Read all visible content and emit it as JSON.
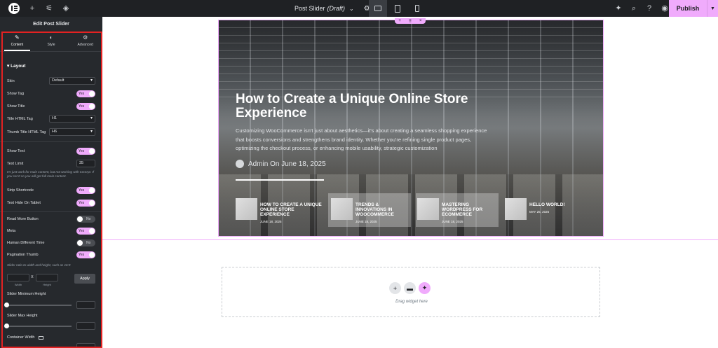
{
  "topbar": {
    "page_name": "Post Slider",
    "page_status": "(Draft)",
    "publish_label": "Publish"
  },
  "panel": {
    "title": "Edit Post Slider",
    "tabs": [
      {
        "label": "Content",
        "icon": "pencil-icon",
        "active": true
      },
      {
        "label": "Style",
        "icon": "half-circle-icon",
        "active": false
      },
      {
        "label": "Advanced",
        "icon": "gear-icon",
        "active": false
      }
    ],
    "section": "Layout",
    "skin_label": "Skin",
    "skin_value": "Default",
    "show_tag_label": "Show Tag",
    "show_tag_value": "Yes",
    "show_title_label": "Show Title",
    "show_title_value": "Yes",
    "title_tag_label": "Title HTML Tag",
    "title_tag_value": "H1",
    "thumb_tag_label": "Thumb Title HTML Tag",
    "thumb_tag_value": "H6",
    "show_text_label": "Show Text",
    "show_text_value": "Yes",
    "text_limit_label": "Text Limit",
    "text_limit_value": "35",
    "text_limit_note": "It's just work for main content, but not working with excerpt. If you set 0 so you will get full main content.",
    "strip_label": "Strip Shortcode",
    "strip_value": "Yes",
    "text_hide_label": "Text Hide On Tablet",
    "text_hide_value": "Yes",
    "read_more_label": "Read More Button",
    "read_more_value": "No",
    "meta_label": "Meta",
    "meta_value": "Yes",
    "human_time_label": "Human Different Time",
    "human_time_value": "No",
    "pagination_label": "Pagination Thumb",
    "pagination_value": "Yes",
    "ratio_note": "Slider ratio to width and height, such as 16:9",
    "ratio_sep": "X",
    "ratio_width_label": "Width",
    "ratio_height_label": "Height",
    "apply_label": "Apply",
    "min_height_label": "Slider Minimum Height",
    "max_height_label": "Slider Max Height",
    "container_width_label": "Container Width"
  },
  "slider": {
    "title": "How to Create a Unique Online Store Experience",
    "excerpt": "Customizing WooCommerce isn't just about aesthetics—it's about creating a seamless shopping experience that boosts conversions and strengthens brand identity. Whether you're refining single product pages, optimizing the checkout process, or enhancing mobile usability, strategic customization",
    "author_line": "Admin On June 18, 2025",
    "thumbs": [
      {
        "title": "How to Create a Unique Online Store Experience",
        "date": "JUNE 18, 2025"
      },
      {
        "title": "Trends & Innovations in WooCommerce",
        "date": "JUNE 18, 2025"
      },
      {
        "title": "Mastering WordPress for eCommerce",
        "date": "JUNE 18, 2025"
      },
      {
        "title": "Hello world!",
        "date": "MAY 25, 2025"
      }
    ]
  },
  "dropzone": {
    "text": "Drag widget here"
  }
}
